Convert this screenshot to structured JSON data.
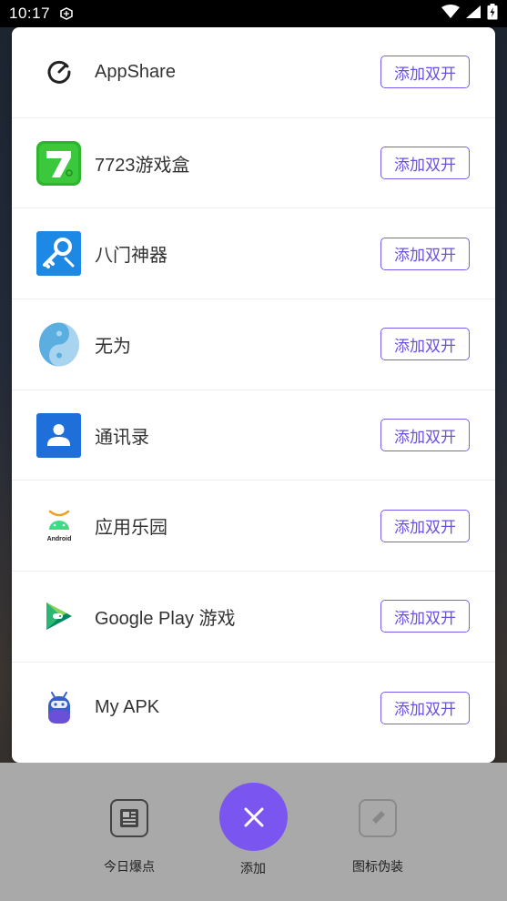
{
  "status_bar": {
    "time": "10:17"
  },
  "apps": [
    {
      "name": "AppShare",
      "icon": "appshare-icon",
      "button": "添加双开"
    },
    {
      "name": "7723游戏盒",
      "icon": "7723-game-box-icon",
      "button": "添加双开"
    },
    {
      "name": "八门神器",
      "icon": "bamen-shenqi-icon",
      "button": "添加双开"
    },
    {
      "name": "无为",
      "icon": "yin-yang-icon",
      "button": "添加双开"
    },
    {
      "name": "通讯录",
      "icon": "contacts-icon",
      "button": "添加双开"
    },
    {
      "name": "应用乐园",
      "icon": "android-icon",
      "button": "添加双开"
    },
    {
      "name": "Google Play 游戏",
      "icon": "google-play-games-icon",
      "button": "添加双开"
    },
    {
      "name": "My APK",
      "icon": "my-apk-icon",
      "button": "添加双开"
    }
  ],
  "bottom_nav": {
    "news_label": "今日爆点",
    "add_label": "添加",
    "disguise_label": "图标伪装"
  },
  "colors": {
    "accent": "#7a55ef",
    "button_text": "#6b4fe8",
    "bottom_bar": "#a9a9a9"
  }
}
